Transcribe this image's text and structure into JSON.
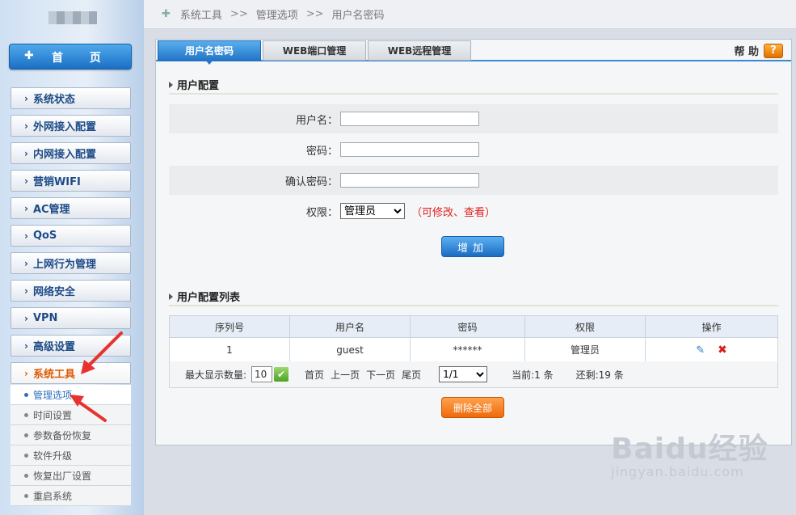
{
  "sidebar": {
    "home_label": "首 页",
    "items": [
      {
        "label": "系统状态"
      },
      {
        "label": "外网接入配置"
      },
      {
        "label": "内网接入配置"
      },
      {
        "label": "营销WIFI"
      },
      {
        "label": "AC管理"
      },
      {
        "label": "QoS"
      },
      {
        "label": "上网行为管理"
      },
      {
        "label": "网络安全"
      },
      {
        "label": "VPN"
      },
      {
        "label": "高级设置"
      },
      {
        "label": "系统工具"
      }
    ],
    "submenu": [
      {
        "label": "管理选项"
      },
      {
        "label": "时间设置"
      },
      {
        "label": "参数备份恢复"
      },
      {
        "label": "软件升级"
      },
      {
        "label": "恢复出厂设置"
      },
      {
        "label": "重启系统"
      }
    ]
  },
  "breadcrumb": {
    "items": [
      "系统工具",
      "管理选项",
      "用户名密码"
    ],
    "sep": ">>"
  },
  "tabs": [
    {
      "label": "用户名密码"
    },
    {
      "label": "WEB端口管理"
    },
    {
      "label": "WEB远程管理"
    }
  ],
  "help": {
    "label": "帮 助",
    "icon": "?"
  },
  "user_config": {
    "title": "用户配置",
    "username_label": "用户名：",
    "password_label": "密码：",
    "confirm_label": "确认密码：",
    "permission_label": "权限：",
    "permission_value": "管理员",
    "permission_note": "（可修改、查看）",
    "add_button": "增加"
  },
  "user_list": {
    "title": "用户配置列表",
    "columns": [
      "序列号",
      "用户名",
      "密码",
      "权限",
      "操作"
    ],
    "rows": [
      {
        "index": "1",
        "username": "guest",
        "password": "******",
        "permission": "管理员"
      }
    ]
  },
  "pager": {
    "max_label": "最大显示数量:",
    "max_value": "10",
    "first": "首页",
    "prev": "上一页",
    "next": "下一页",
    "last": "尾页",
    "page_value": "1/1",
    "current": "当前:1 条",
    "remaining": "还剩:19 条"
  },
  "delete_all_button": "删除全部",
  "watermark": {
    "brand": "Baidu经验",
    "url": "jingyan.baidu.com"
  },
  "colors": {
    "accent_blue": "#2477c8",
    "accent_orange": "#ee6a0c",
    "active_menu": "#e05a00",
    "arrow_red": "#e8322e"
  }
}
